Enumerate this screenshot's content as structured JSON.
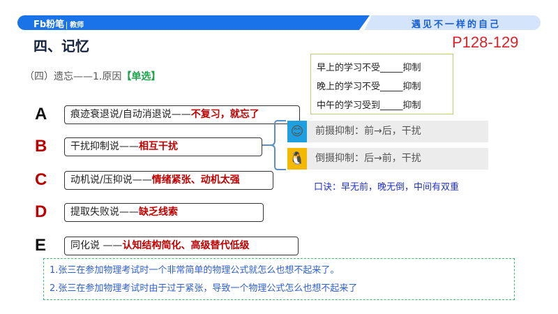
{
  "header": {
    "logo": "Fb粉笔",
    "logo_sub": "教师",
    "slogan": "遇见不一样的自己"
  },
  "title": "四、记忆",
  "pages": "P128-129",
  "subtitle": {
    "text": "（四）遗忘——1.原因",
    "tag": "【单选】"
  },
  "question_box": [
    "早上的学习不受_____抑制",
    "晚上的学习不受_____抑制",
    "中午的学习受到_____抑制"
  ],
  "options": [
    {
      "letter": "A",
      "text": "痕迹衰退说/自动消退说——",
      "highlight": "不复习，就忘了",
      "color": "#111111"
    },
    {
      "letter": "B",
      "text": "干扰抑制说——",
      "highlight": "相互干扰",
      "color": "#c00000"
    },
    {
      "letter": "C",
      "text": "动机说/压抑说——",
      "highlight": "情绪紧张、动机太强",
      "color": "#c00000"
    },
    {
      "letter": "D",
      "text": "提取失败说——",
      "highlight": "缺乏线索",
      "color": "#c00000"
    },
    {
      "letter": "E",
      "text": "同化说 ——",
      "highlight": "认知结构简化、高级替代低级",
      "color": "#111111"
    }
  ],
  "inhibition": [
    {
      "icon": "smiley-icon",
      "text": "前摄抑制：前→后，干扰"
    },
    {
      "icon": "penguin-icon",
      "text": "倒摄抑制：后→前，干扰"
    }
  ],
  "mnemonic": "口诀：早无前，晚无倒，中间有双重",
  "examples": [
    "1.张三在参加物理考试时一个非常简单的物理公式就怎么也想不起来了。",
    "2.张三在参加物理考试时由于过于紧张，导致一个物理公式怎么也想不起来了"
  ]
}
